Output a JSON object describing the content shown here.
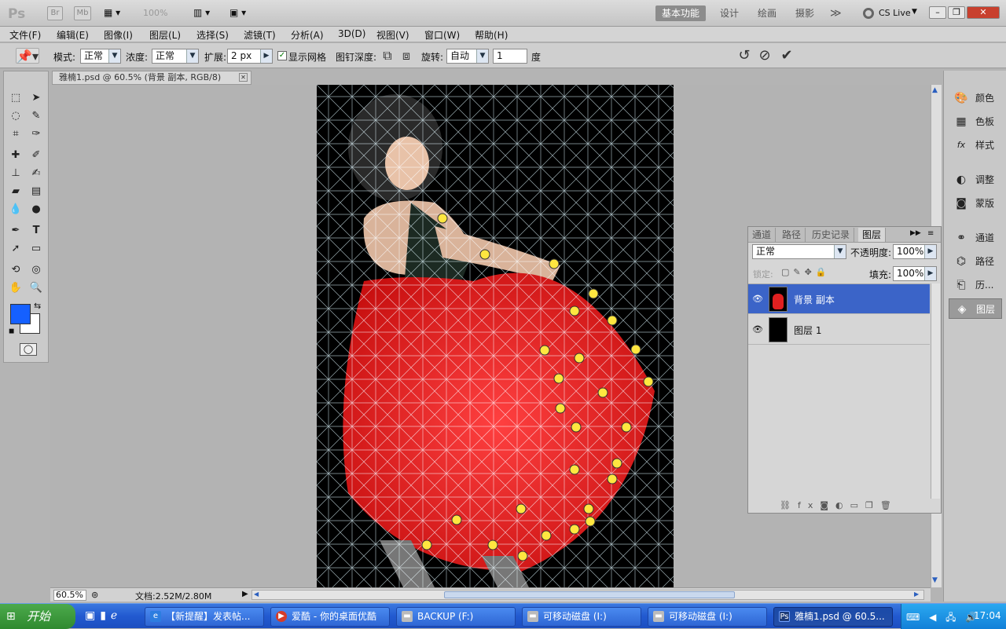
{
  "appbar": {
    "logo": "Ps",
    "br": "Br",
    "mb": "Mb",
    "zoom": "100%",
    "workspaces": [
      "基本功能",
      "设计",
      "绘画",
      "摄影"
    ],
    "more": "≫",
    "cslive": "CS Live"
  },
  "menu": [
    "文件(F)",
    "编辑(E)",
    "图像(I)",
    "图层(L)",
    "选择(S)",
    "滤镜(T)",
    "分析(A)",
    "3D(D)",
    "视图(V)",
    "窗口(W)",
    "帮助(H)"
  ],
  "options": {
    "mode_label": "模式:",
    "mode_value": "正常",
    "density_label": "浓度:",
    "density_value": "正常",
    "expand_label": "扩展:",
    "expand_value": "2 px",
    "show_mesh_label": "显示网格",
    "pin_depth_label": "图钉深度:",
    "rotate_label": "旋转:",
    "rotate_value": "自动",
    "angle_value": "1",
    "degree_label": "度"
  },
  "document": {
    "tab_title": "雅楠1.psd @ 60.5% (背景 副本, RGB/8)",
    "zoom": "60.5%",
    "doc_size": "文档:2.52M/2.80M"
  },
  "right_panel": {
    "items": [
      "颜色",
      "色板",
      "样式",
      "调整",
      "蒙版",
      "通道",
      "路径",
      "历...",
      "图层"
    ]
  },
  "layers_panel": {
    "tabs": [
      "通道",
      "路径",
      "历史记录",
      "图层"
    ],
    "blend_mode": "正常",
    "opacity_label": "不透明度:",
    "opacity_value": "100%",
    "lock_label": "锁定:",
    "fill_label": "填充:",
    "fill_value": "100%",
    "layers": [
      {
        "name": "背景 副本",
        "selected": true
      },
      {
        "name": "图层 1",
        "selected": false
      }
    ]
  },
  "taskbar": {
    "start": "开始",
    "tasks": [
      "【新提醒】发表帖...",
      "爱酷 - 你的桌面优酷",
      "BACKUP (F:)",
      "可移动磁盘 (I:)",
      "可移动磁盘 (I:)",
      "雅楠1.psd @ 60.5..."
    ],
    "clock": "17:04"
  },
  "colors": {
    "foreground": "#1560ff",
    "background": "#ffffff",
    "selected_layer": "#3b64c8"
  }
}
